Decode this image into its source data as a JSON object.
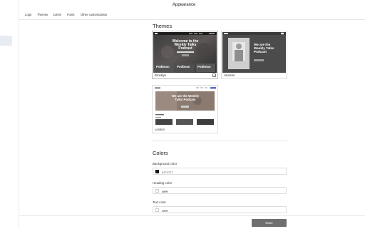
{
  "header": {
    "title": "Appearance"
  },
  "tabs": [
    {
      "label": "Logo"
    },
    {
      "label": "Themes"
    },
    {
      "label": "Colors"
    },
    {
      "label": "Fonts"
    },
    {
      "label": "Other customization"
    }
  ],
  "themes": {
    "title": "Themes",
    "items": [
      {
        "name": "Brooklyn",
        "selected": true,
        "preview": {
          "heading": "Welcome to the Weekly Talks Podcast",
          "cards": [
            "Podbean",
            "Podbean",
            "Podbean"
          ]
        }
      },
      {
        "name": "Jackson",
        "selected": false,
        "preview": {
          "heading": "We are the Weekly Talks Podcast"
        }
      },
      {
        "name": "London",
        "selected": false,
        "preview": {
          "heading": "We are the Weekly Talks Podcast"
        }
      }
    ]
  },
  "colors": {
    "title": "Colors",
    "fields": [
      {
        "label": "Background color",
        "value": "#171717",
        "swatch": "#171717"
      },
      {
        "label": "Heading color",
        "value": "#ffffff",
        "swatch": "#ffffff"
      },
      {
        "label": "Text color",
        "value": "#ffffff",
        "swatch": "#ffffff"
      }
    ]
  },
  "footer": {
    "save_label": "Save"
  },
  "accent": "#6f6f6f"
}
